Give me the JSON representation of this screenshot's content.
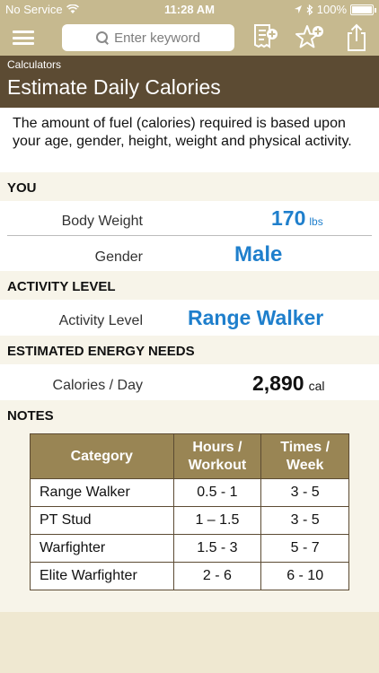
{
  "status": {
    "carrier": "No Service",
    "time": "11:28 AM",
    "battery": "100%"
  },
  "nav": {
    "search_placeholder": "Enter keyword"
  },
  "header": {
    "breadcrumb": "Calculators",
    "title": "Estimate Daily Calories"
  },
  "intro": "The amount of fuel (calories) required is based upon your age, gender, height, weight and physical activity.",
  "sections": {
    "you": "YOU",
    "activity": "ACTIVITY LEVEL",
    "energy": "ESTIMATED ENERGY NEEDS",
    "notes": "NOTES"
  },
  "you": {
    "weight_label": "Body Weight",
    "weight_value": "170",
    "weight_unit": "lbs",
    "gender_label": "Gender",
    "gender_value": "Male"
  },
  "activity": {
    "label": "Activity Level",
    "value": "Range Walker"
  },
  "energy": {
    "label": "Calories / Day",
    "value": "2,890",
    "unit": "cal"
  },
  "notes_table": {
    "headers": [
      "Category",
      "Hours / Workout",
      "Times / Week"
    ],
    "rows": [
      [
        "Range Walker",
        "0.5 - 1",
        "3 - 5"
      ],
      [
        "PT Stud",
        "1 – 1.5",
        "3 - 5"
      ],
      [
        "Warfighter",
        "1.5 - 3",
        "5 - 7"
      ],
      [
        "Elite Warfighter",
        "2 - 6",
        "6 - 10"
      ]
    ]
  },
  "colors": {
    "nav_bar": "#c6b98f",
    "header": "#5c4b33",
    "accent_blue": "#1f7fcc",
    "table_header": "#998554"
  }
}
